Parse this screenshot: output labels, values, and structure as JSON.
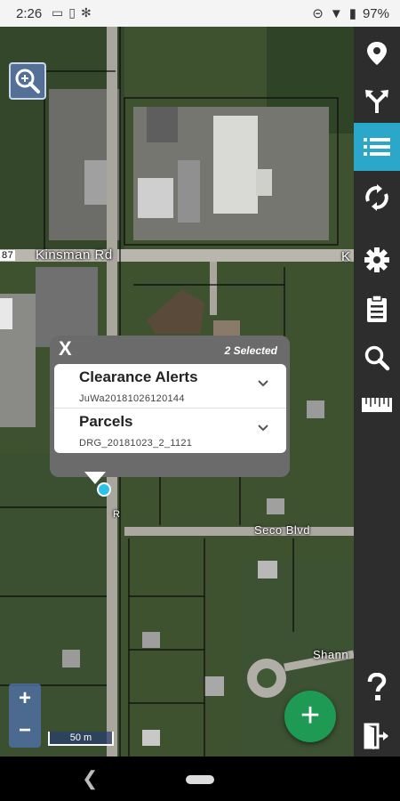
{
  "status_bar": {
    "time": "2:26",
    "battery": "97%"
  },
  "map": {
    "streets": {
      "kinsman": "Kinsman Rd",
      "seco": "Seco Blvd",
      "shann": "Shann",
      "route_num": "87",
      "k_edge": "K",
      "r_edge": "R"
    },
    "scale_label": "50 m",
    "zoom_in": "+",
    "zoom_out": "−",
    "fab_label": "+"
  },
  "popup": {
    "close_label": "X",
    "selected_text": "2 Selected",
    "items": [
      {
        "title": "Clearance Alerts",
        "subtitle": "JuWa20181026120144"
      },
      {
        "title": "Parcels",
        "subtitle": "DRG_20181023_2_1121"
      }
    ]
  },
  "toolbar": {
    "items": [
      {
        "icon": "location-pin-icon",
        "active": false
      },
      {
        "icon": "route-split-icon",
        "active": false
      },
      {
        "icon": "list-icon",
        "active": true
      },
      {
        "icon": "sync-icon",
        "active": false
      },
      {
        "icon": "gear-icon",
        "active": false
      },
      {
        "icon": "clipboard-icon",
        "active": false
      },
      {
        "icon": "search-icon",
        "active": false
      },
      {
        "icon": "ruler-icon",
        "active": false
      },
      {
        "icon": "help-icon",
        "active": false
      },
      {
        "icon": "exit-icon",
        "active": false
      }
    ]
  },
  "colors": {
    "toolbar_bg": "#2d2d2d",
    "toolbar_active": "#2aa7c9",
    "fab": "#1f9a55",
    "popup_bg": "#6b6b6b"
  }
}
